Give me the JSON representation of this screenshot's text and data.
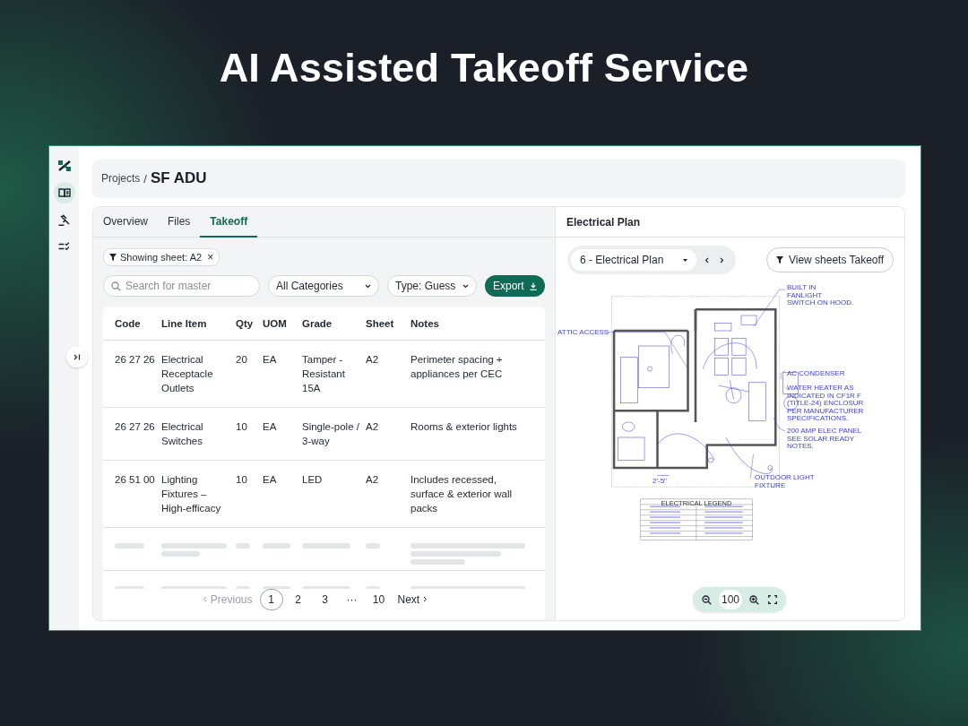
{
  "headline": "AI Assisted Takeoff Service",
  "sidebar": {
    "items": [
      {
        "kind": "logo",
        "selected": false
      },
      {
        "kind": "book",
        "selected": true
      },
      {
        "kind": "gavel",
        "selected": false
      },
      {
        "kind": "checklist",
        "selected": false
      }
    ]
  },
  "breadcrumb": {
    "parent": "Projects",
    "separator": "/",
    "current": "SF ADU"
  },
  "tabs": [
    {
      "label": "Overview",
      "selected": false
    },
    {
      "label": "Files",
      "selected": false
    },
    {
      "label": "Takeoff",
      "selected": true
    }
  ],
  "filter_chip": {
    "label": "Showing sheet: A2",
    "close": "×"
  },
  "search": {
    "placeholder": "Search for master"
  },
  "category_select": {
    "value": "All Categories"
  },
  "type_select": {
    "value": "Type: Guess"
  },
  "export_button": {
    "label": "Export"
  },
  "table": {
    "columns": [
      "Code",
      "Line Item",
      "Qty",
      "UOM",
      "Grade",
      "Sheet",
      "Notes"
    ],
    "rows": [
      {
        "kind": "item",
        "cells": [
          "26 27 26",
          "Electrical Receptacle Outlets",
          "20",
          "EA",
          "Tamper - Resistant 15A",
          "A2",
          "Perimeter spacing + appliances per CEC"
        ]
      },
      {
        "kind": "item",
        "cells": [
          "26 27 26",
          "Electrical Switches",
          "10",
          "EA",
          "Single-pole / 3-way",
          "A2",
          "Rooms & exterior lights"
        ]
      },
      {
        "kind": "item",
        "cells": [
          "26 51 00",
          "Lighting Fixtures – High-efficacy",
          "10",
          "EA",
          "LED",
          "A2",
          "Includes recessed, surface & exterior wall packs"
        ]
      },
      {
        "kind": "loading"
      },
      {
        "kind": "loading"
      }
    ]
  },
  "pagination": {
    "previous": {
      "label": "Previous",
      "disabled": true
    },
    "pages": [
      {
        "label": "1",
        "selected": true
      },
      {
        "label": "2",
        "selected": false
      },
      {
        "label": "3",
        "selected": false
      },
      {
        "label": "···",
        "selected": false
      },
      {
        "label": "10",
        "selected": false
      }
    ],
    "next": {
      "label": "Next",
      "disabled": false
    }
  },
  "viewer": {
    "title": "Electrical Plan",
    "sheet_select": {
      "value": "6 - Electrical Plan"
    },
    "filter_button": {
      "label": "View sheets Takeoff"
    },
    "plan": {
      "annotations": [
        {
          "lines": [
            "BUILT IN",
            "FANLIGHT",
            "SWITCH ON HOOD."
          ]
        },
        {
          "lines": [
            "ATTIC ACCESS"
          ]
        },
        {
          "lines": [
            "AC CONDENSER"
          ]
        },
        {
          "lines": [
            "WATER HEATER AS",
            "INDICATED IN CF1R F",
            "(TITLE-24) ENCLOSUR",
            "PER MANUFACTURER",
            "SPECIFICATIONS."
          ]
        },
        {
          "lines": [
            "200 AMP ELEC PANEL",
            "SEE SOLAR READY",
            "NOTES."
          ]
        },
        {
          "lines": [
            "OUTDOOR LIGHT",
            "FIXTURE"
          ]
        }
      ],
      "dimension": "2'-5\"",
      "legend_title": "ELECTRICAL LEGEND"
    },
    "zoom": {
      "value": "100"
    }
  }
}
